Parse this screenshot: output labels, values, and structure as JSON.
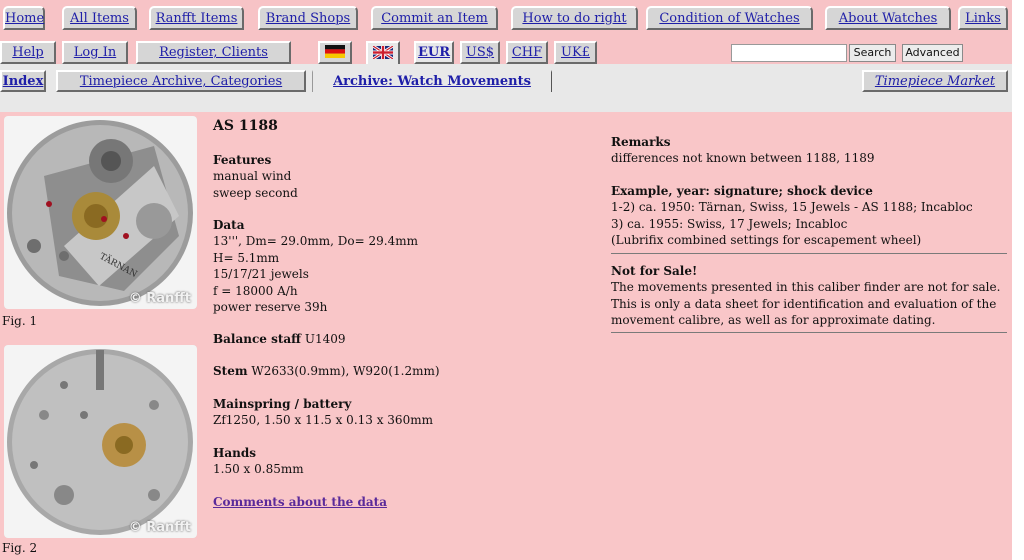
{
  "nav": {
    "row1": [
      "Home",
      "All Items",
      "Ranfft Items",
      "Brand Shops",
      "Commit an Item",
      "How to do right",
      "Condition of Watches",
      "About Watches",
      "Links"
    ],
    "row2": [
      "Help",
      "Log In",
      "Register, Clients"
    ],
    "currencies": [
      "EUR",
      "US$",
      "CHF",
      "UK£"
    ],
    "flags": [
      "german-flag",
      "uk-flag"
    ],
    "row3": [
      "Index",
      "Timepiece Archive, Categories",
      "Archive: Watch Movements",
      "Timepiece Market"
    ]
  },
  "search": {
    "placeholder": "",
    "search_label": "Search",
    "advanced_label": "Advanced"
  },
  "figures": [
    {
      "caption": "Fig. 1",
      "watermark": "© Ranfft"
    },
    {
      "caption": "Fig. 2",
      "watermark": "© Ranfft"
    }
  ],
  "movement": {
    "title": "AS 1188",
    "features_h": "Features",
    "features": [
      "manual wind",
      "sweep second"
    ],
    "data_h": "Data",
    "data": [
      "13''', Dm= 29.0mm, Do= 29.4mm",
      "H= 5.1mm",
      "15/17/21 jewels",
      "f = 18000 A/h",
      "power reserve 39h"
    ],
    "balance_h": "Balance staff",
    "balance": " U1409",
    "stem_h": "Stem",
    "stem": " W2633(0.9mm), W920(1.2mm)",
    "mainspring_h": "Mainspring / battery",
    "mainspring": "Zf1250, 1.50 x 11.5 x 0.13 x 360mm",
    "hands_h": "Hands",
    "hands": "1.50 x 0.85mm",
    "comments_link": "Comments about the data"
  },
  "remarks": {
    "remarks_h": "Remarks",
    "remarks": "differences not known between 1188, 1189",
    "example_h": "Example, year: signature; shock device",
    "examples": [
      "1-2) ca. 1950: Tärnan, Swiss, 15 Jewels - AS 1188; Incabloc",
      "3) ca. 1955: Swiss, 17 Jewels; Incabloc",
      "(Lubrifix combined settings for escapement wheel)"
    ],
    "sale_h": "Not for Sale!",
    "sale": "The movements presented in this caliber finder are not for sale. This is only a data sheet for identification and evaluation of the movement calibre, as well as for approximate dating."
  }
}
